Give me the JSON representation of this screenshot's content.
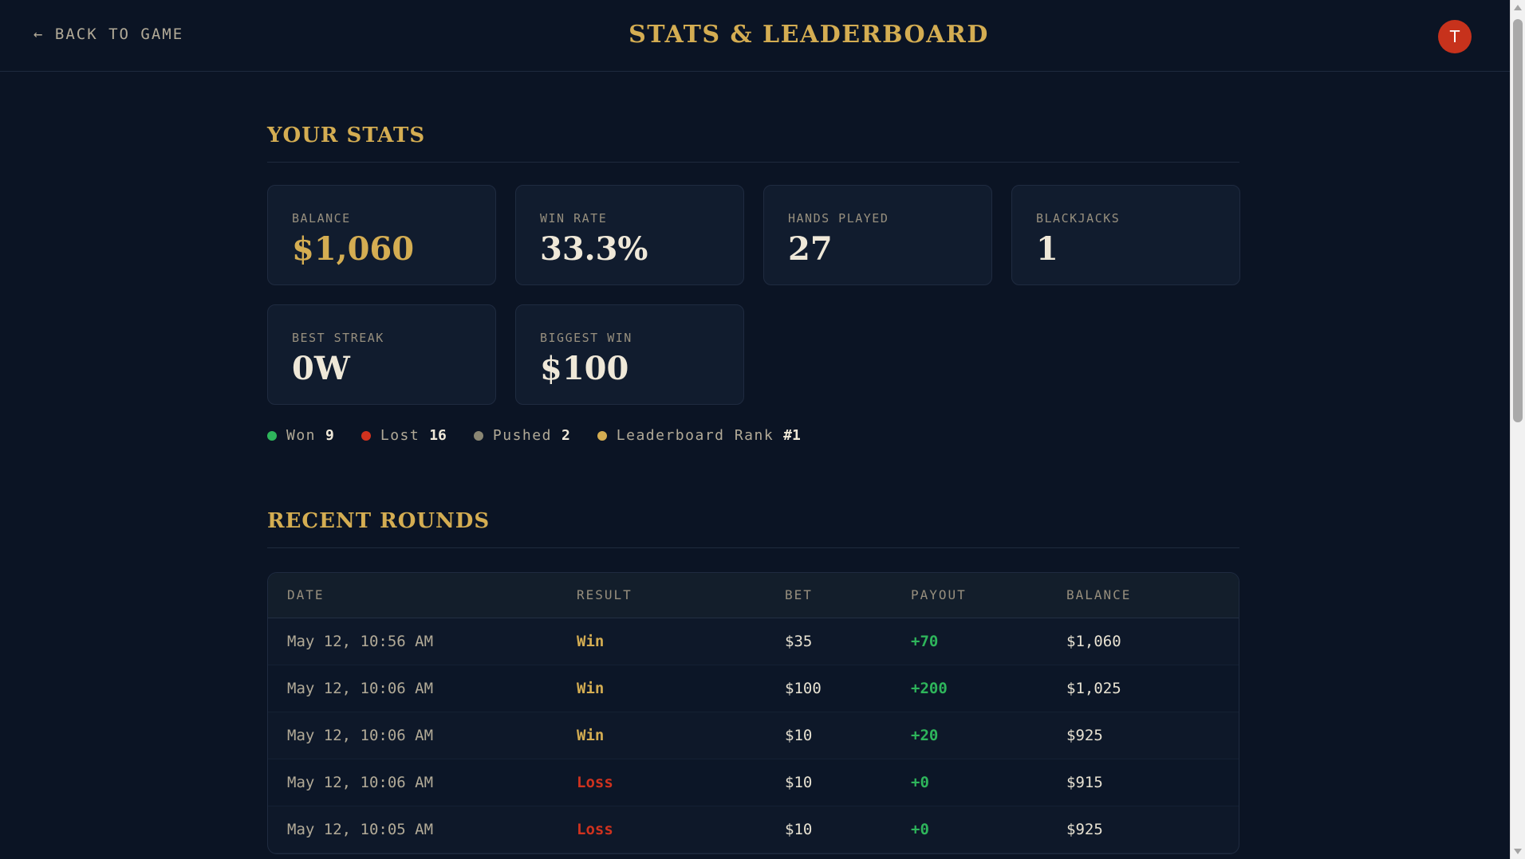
{
  "header": {
    "back_label": "← BACK TO GAME",
    "title": "STATS & LEADERBOARD",
    "avatar_initial": "T"
  },
  "stats": {
    "section_title": "YOUR STATS",
    "cards": [
      {
        "label": "BALANCE",
        "value": "$1,060"
      },
      {
        "label": "WIN RATE",
        "value": "33.3%"
      },
      {
        "label": "HANDS PLAYED",
        "value": "27"
      },
      {
        "label": "BLACKJACKS",
        "value": "1"
      },
      {
        "label": "BEST STREAK",
        "value": "0W"
      },
      {
        "label": "BIGGEST WIN",
        "value": "$100"
      }
    ],
    "legend": [
      {
        "label": "Won",
        "count": "9",
        "color": "#2eb55b"
      },
      {
        "label": "Lost",
        "count": "16",
        "color": "#d0321e"
      },
      {
        "label": "Pushed",
        "count": "2",
        "color": "#8a8673"
      },
      {
        "label": "Leaderboard Rank",
        "count": "#1",
        "color": "#d4ad52"
      }
    ]
  },
  "rounds": {
    "section_title": "RECENT ROUNDS",
    "columns": [
      "DATE",
      "RESULT",
      "BET",
      "PAYOUT",
      "BALANCE"
    ],
    "rows": [
      {
        "date": "May 12, 10:56 AM",
        "result": "Win",
        "bet": "$35",
        "payout": "+70",
        "balance": "$1,060"
      },
      {
        "date": "May 12, 10:06 AM",
        "result": "Win",
        "bet": "$100",
        "payout": "+200",
        "balance": "$1,025"
      },
      {
        "date": "May 12, 10:06 AM",
        "result": "Win",
        "bet": "$10",
        "payout": "+20",
        "balance": "$925"
      },
      {
        "date": "May 12, 10:06 AM",
        "result": "Loss",
        "bet": "$10",
        "payout": "+0",
        "balance": "$915"
      },
      {
        "date": "May 12, 10:05 AM",
        "result": "Loss",
        "bet": "$10",
        "payout": "+0",
        "balance": "$925"
      }
    ]
  },
  "colors": {
    "background": "#0b1424",
    "accent_gold": "#d4ad52",
    "win_green": "#2eb55b",
    "loss_red": "#d0321e",
    "avatar_red": "#c7321c"
  }
}
